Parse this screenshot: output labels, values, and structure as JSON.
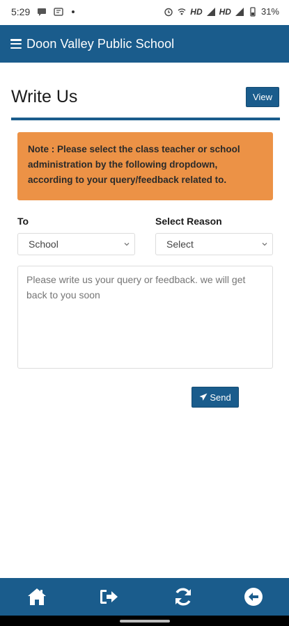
{
  "status_bar": {
    "time": "5:29",
    "right_text": "HD",
    "right_text2": "HD",
    "battery": "31%"
  },
  "app_bar": {
    "title": "Doon Valley Public School"
  },
  "page": {
    "title": "Write Us",
    "view_label": "View"
  },
  "note": {
    "text": "Note : Please select the class teacher or school administration by the following dropdown, according to your query/feedback related to."
  },
  "form": {
    "to_label": "To",
    "to_value": "School",
    "reason_label": "Select Reason",
    "reason_value": "Select",
    "message_placeholder": "Please write us your query or feedback. we will get back to you soon",
    "send_label": "Send"
  },
  "bottom_nav": {
    "icons": [
      "home-icon",
      "logout-icon",
      "refresh-icon",
      "back-icon"
    ]
  },
  "colors": {
    "primary": "#1a5c8c",
    "note_bg": "#ec9246"
  }
}
